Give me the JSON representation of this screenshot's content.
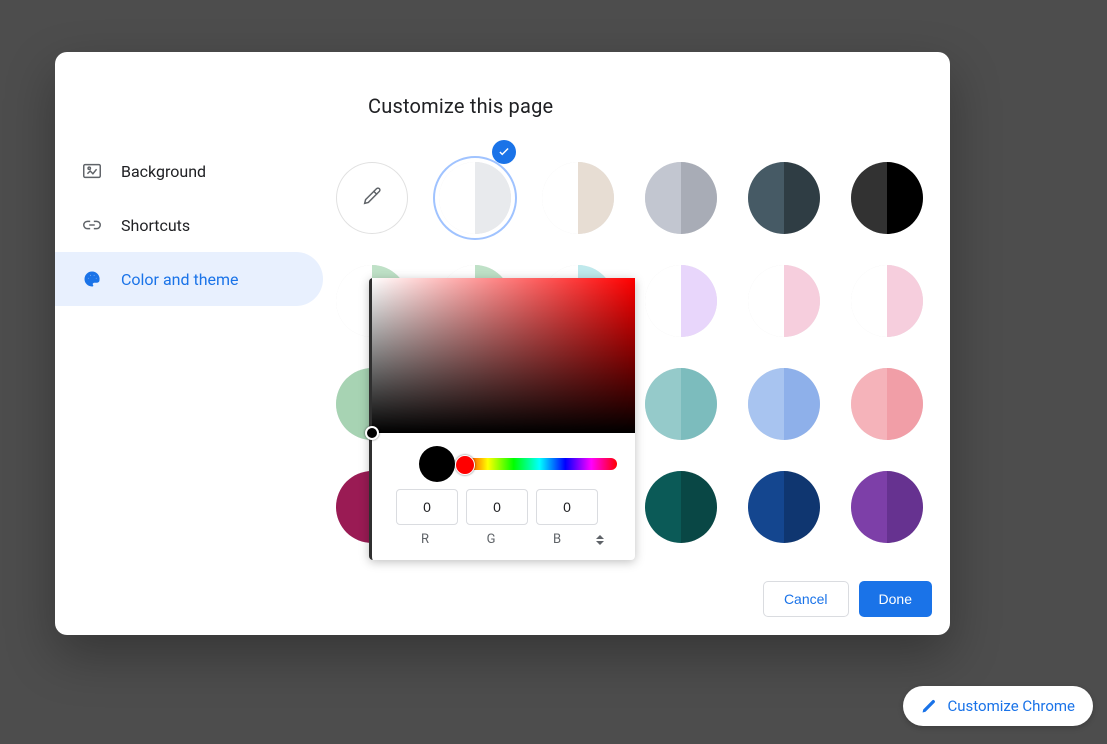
{
  "dialog": {
    "title": "Customize this page",
    "cancel_label": "Cancel",
    "done_label": "Done"
  },
  "sidebar": {
    "items": [
      {
        "label": "Background",
        "active": false
      },
      {
        "label": "Shortcuts",
        "active": false
      },
      {
        "label": "Color and theme",
        "active": true
      }
    ]
  },
  "swatches": [
    {
      "kind": "custom",
      "selected": false
    },
    {
      "left": "#ffffff",
      "right": "#e8eaed",
      "selected": true
    },
    {
      "left": "#ffffff",
      "right": "#e7ddd3",
      "selected": false
    },
    {
      "left": "#c2c6d0",
      "right": "#a8acb6",
      "selected": false
    },
    {
      "left": "#465a65",
      "right": "#2f3d44",
      "selected": false
    },
    {
      "left": "#323232",
      "right": "#000000",
      "selected": false
    },
    {
      "left": "#ffffff",
      "right": "#bfe1c7",
      "selected": false
    },
    {
      "left": "#ffffff",
      "right": "#bfe1c7",
      "selected": false
    },
    {
      "left": "#ffffff",
      "right": "#bfe9ec",
      "selected": false
    },
    {
      "left": "#ffffff",
      "right": "#e8d6fb",
      "selected": false
    },
    {
      "left": "#ffffff",
      "right": "#f6cedd",
      "selected": false
    },
    {
      "left": "#ffffff",
      "right": "#f6cedd",
      "selected": false
    },
    {
      "left": "#a7d3b3",
      "right": "#8fc6a0",
      "selected": false
    },
    {
      "left": "#a7d3b3",
      "right": "#8fc6a0",
      "selected": false
    },
    {
      "left": "#73b6c0",
      "right": "#5fa9b6",
      "selected": false
    },
    {
      "left": "#95caca",
      "right": "#7cbcbd",
      "selected": false
    },
    {
      "left": "#a8c4f0",
      "right": "#8eb0ea",
      "selected": false
    },
    {
      "left": "#f5b3ba",
      "right": "#f19ea7",
      "selected": false
    },
    {
      "left": "#9a1b54",
      "right": "#7f1644",
      "selected": false
    },
    {
      "left": "#b62f2f",
      "right": "#972424",
      "selected": false
    },
    {
      "left": "#24682e",
      "right": "#1c5224",
      "selected": false
    },
    {
      "left": "#0b5a57",
      "right": "#094745",
      "selected": false
    },
    {
      "left": "#14468f",
      "right": "#0f3670",
      "selected": false
    },
    {
      "left": "#7d3fa8",
      "right": "#663290",
      "selected": false
    }
  ],
  "picker": {
    "r": "0",
    "g": "0",
    "b": "0",
    "labels": {
      "r": "R",
      "g": "G",
      "b": "B"
    }
  },
  "customize_chrome_label": "Customize Chrome"
}
